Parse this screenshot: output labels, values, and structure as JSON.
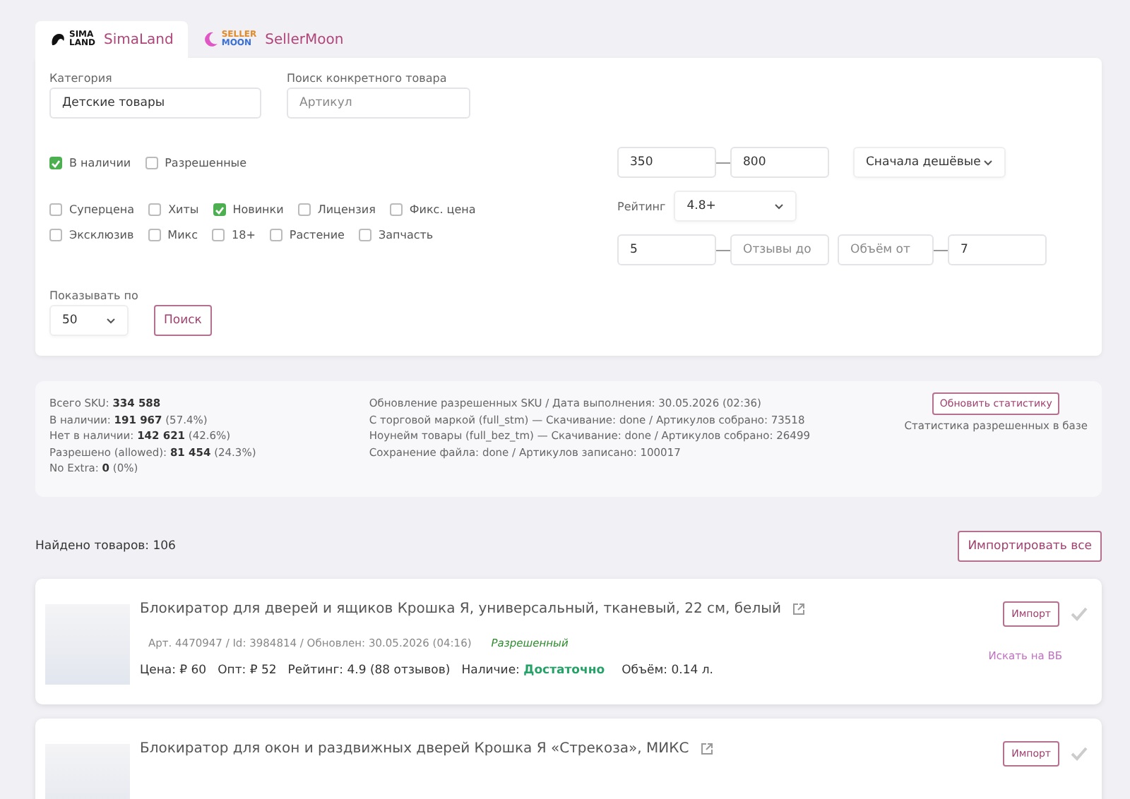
{
  "tabs": [
    {
      "logo_text": [
        "SIMA",
        "LAND"
      ],
      "label": "SimaLand",
      "selected": true
    },
    {
      "logo_text": [
        "SELLER",
        "MOON"
      ],
      "label": "SellerMoon",
      "selected": false
    }
  ],
  "filters": {
    "category": {
      "label": "Категория",
      "value": "Детские товары"
    },
    "search": {
      "label": "Поиск конкретного товара",
      "placeholder": "Артикул"
    },
    "checkbox_rows": [
      [
        {
          "label": "В наличии",
          "checked": true
        },
        {
          "label": "Разрешенные",
          "checked": false
        }
      ],
      [
        {
          "label": "Суперцена",
          "checked": false
        },
        {
          "label": "Хиты",
          "checked": false
        },
        {
          "label": "Новинки",
          "checked": true
        },
        {
          "label": "Лицензия",
          "checked": false
        },
        {
          "label": "Фикс. цена",
          "checked": false
        }
      ],
      [
        {
          "label": "Эксклюзив",
          "checked": false
        },
        {
          "label": "Микс",
          "checked": false
        },
        {
          "label": "18+",
          "checked": false
        },
        {
          "label": "Растение",
          "checked": false
        },
        {
          "label": "Запчасть",
          "checked": false
        }
      ]
    ],
    "per_page": {
      "label": "Показывать по",
      "value": "50"
    },
    "search_button": "Поиск",
    "price_from": "350",
    "price_to": "800",
    "sort": "Сначала дешёвые",
    "rating": {
      "label": "Рейтинг",
      "value": "4.8+"
    },
    "reviews_from": "5",
    "reviews_to_placeholder": "Отзывы до",
    "volume_from_placeholder": "Объём от",
    "volume_to": "7"
  },
  "stats": {
    "totals": [
      "Всего SKU: **334 588**",
      "В наличии: **191 967** (57.4%)",
      "Нет в наличии: **142 621** (42.6%)",
      "Разрешено (allowed): **81 454** (24.3%)",
      "No Extra: **0** (0%)"
    ],
    "updates": [
      "Обновление разрешенных SKU / Дата выполнения: 30.05.2026 (02:36)",
      "С торговой маркой (full_stm) — Скачивание: done / Артикулов собрано: 73518",
      "Ноунейм товары (full_bez_tm) — Скачивание: done / Артикулов собрано: 26499",
      "Сохранение файла: done / Артикулов записано: 100017"
    ],
    "refresh_button": "Обновить статистику",
    "caption": "Статистика разрешенных в базе"
  },
  "found": "Найдено товаров: 106",
  "import_all_button": "Импортировать все",
  "products": [
    {
      "title": "Блокиратор для дверей и ящиков Крошка Я, универсальный, тканевый, 22 см, белый",
      "meta": "Арт. 4470947 / Id: 3984814 / Обновлен: 30.05.2026 (04:16)",
      "status": "Разрешенный",
      "price": "Цена: ₽ 60",
      "wholesale": "Опт: ₽ 52",
      "rating": "Рейтинг: 4.9 (88 отзывов)",
      "stock_label": "Наличие:",
      "stock_value": "Достаточно",
      "volume": "Объём: 0.14 л.",
      "import_button": "Импорт",
      "imported": false,
      "wb_link": "Искать на ВБ"
    },
    {
      "title": "Блокиратор для окон и раздвижных дверей Крошка Я «Стрекоза», МИКС",
      "import_button": "Импорт",
      "imported": false
    }
  ]
}
